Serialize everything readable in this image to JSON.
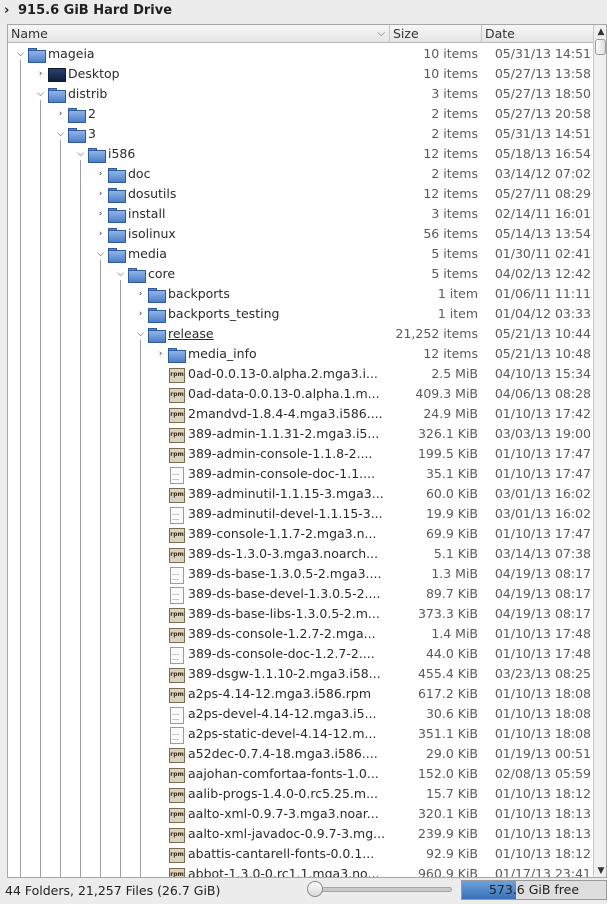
{
  "window": {
    "title": "915.6 GiB Hard Drive"
  },
  "columns": {
    "name": "Name",
    "size": "Size",
    "date": "Date"
  },
  "rows": [
    {
      "label": "mageia",
      "size": "10 items",
      "date": "05/31/13 14:51",
      "level": 0,
      "icon": "folder",
      "arrow": "open"
    },
    {
      "label": "Desktop",
      "size": "10 items",
      "date": "05/27/13 13:58",
      "level": 1,
      "icon": "desktop",
      "arrow": "closed"
    },
    {
      "label": "distrib",
      "size": "3 items",
      "date": "05/27/13 18:50",
      "level": 1,
      "icon": "folder",
      "arrow": "open"
    },
    {
      "label": "2",
      "size": "2 items",
      "date": "05/27/13 20:58",
      "level": 2,
      "icon": "folder",
      "arrow": "closed"
    },
    {
      "label": "3",
      "size": "2 items",
      "date": "05/31/13 14:51",
      "level": 2,
      "icon": "folder",
      "arrow": "open"
    },
    {
      "label": "i586",
      "size": "12 items",
      "date": "05/18/13 16:54",
      "level": 3,
      "icon": "folder",
      "arrow": "open"
    },
    {
      "label": "doc",
      "size": "2 items",
      "date": "03/14/12 07:02",
      "level": 4,
      "icon": "folder",
      "arrow": "closed"
    },
    {
      "label": "dosutils",
      "size": "12 items",
      "date": "05/27/11 08:29",
      "level": 4,
      "icon": "folder",
      "arrow": "closed"
    },
    {
      "label": "install",
      "size": "3 items",
      "date": "02/14/11 16:01",
      "level": 4,
      "icon": "folder",
      "arrow": "closed"
    },
    {
      "label": "isolinux",
      "size": "56 items",
      "date": "05/14/13 13:54",
      "level": 4,
      "icon": "folder",
      "arrow": "closed"
    },
    {
      "label": "media",
      "size": "5 items",
      "date": "01/30/11 02:41",
      "level": 4,
      "icon": "folder",
      "arrow": "open"
    },
    {
      "label": "core",
      "size": "5 items",
      "date": "04/02/13 12:42",
      "level": 5,
      "icon": "folder",
      "arrow": "open"
    },
    {
      "label": "backports",
      "size": "1 item",
      "date": "01/06/11 11:11",
      "level": 6,
      "icon": "folder",
      "arrow": "closed"
    },
    {
      "label": "backports_testing",
      "size": "1 item",
      "date": "01/04/12 03:33",
      "level": 6,
      "icon": "folder",
      "arrow": "closed"
    },
    {
      "label": "release",
      "size": "21,252 items",
      "date": "05/21/13 10:44",
      "level": 6,
      "icon": "folder",
      "arrow": "open",
      "underline": true
    },
    {
      "label": "media_info",
      "size": "12 items",
      "date": "05/21/13 10:48",
      "level": 7,
      "icon": "folder",
      "arrow": "closed"
    },
    {
      "label": "0ad-0.0.13-0.alpha.2.mga3.i...",
      "size": "2.5 MiB",
      "date": "04/10/13 15:34",
      "level": 7,
      "icon": "pkg",
      "arrow": "none"
    },
    {
      "label": "0ad-data-0.0.13-0.alpha.1.m...",
      "size": "409.3 MiB",
      "date": "04/06/13 08:28",
      "level": 7,
      "icon": "pkg",
      "arrow": "none"
    },
    {
      "label": "2mandvd-1.8.4-4.mga3.i586....",
      "size": "24.9 MiB",
      "date": "01/10/13 17:42",
      "level": 7,
      "icon": "pkg",
      "arrow": "none"
    },
    {
      "label": "389-admin-1.1.31-2.mga3.i5...",
      "size": "326.1 KiB",
      "date": "03/03/13 19:00",
      "level": 7,
      "icon": "pkg",
      "arrow": "none"
    },
    {
      "label": "389-admin-console-1.1.8-2....",
      "size": "199.5 KiB",
      "date": "01/10/13 17:47",
      "level": 7,
      "icon": "pkg",
      "arrow": "none"
    },
    {
      "label": "389-admin-console-doc-1.1....",
      "size": "35.1 KiB",
      "date": "01/10/13 17:47",
      "level": 7,
      "icon": "doc",
      "arrow": "none"
    },
    {
      "label": "389-adminutil-1.1.15-3.mga3...",
      "size": "60.0 KiB",
      "date": "03/01/13 16:02",
      "level": 7,
      "icon": "pkg",
      "arrow": "none"
    },
    {
      "label": "389-adminutil-devel-1.1.15-3...",
      "size": "19.9 KiB",
      "date": "03/01/13 16:02",
      "level": 7,
      "icon": "doc",
      "arrow": "none"
    },
    {
      "label": "389-console-1.1.7-2.mga3.n...",
      "size": "69.9 KiB",
      "date": "01/10/13 17:47",
      "level": 7,
      "icon": "pkg",
      "arrow": "none"
    },
    {
      "label": "389-ds-1.3.0-3.mga3.noarch...",
      "size": "5.1 KiB",
      "date": "03/14/13 07:38",
      "level": 7,
      "icon": "pkg",
      "arrow": "none"
    },
    {
      "label": "389-ds-base-1.3.0.5-2.mga3....",
      "size": "1.3 MiB",
      "date": "04/19/13 08:17",
      "level": 7,
      "icon": "doc",
      "arrow": "none"
    },
    {
      "label": "389-ds-base-devel-1.3.0.5-2....",
      "size": "89.7 KiB",
      "date": "04/19/13 08:17",
      "level": 7,
      "icon": "doc",
      "arrow": "none"
    },
    {
      "label": "389-ds-base-libs-1.3.0.5-2.m...",
      "size": "373.3 KiB",
      "date": "04/19/13 08:17",
      "level": 7,
      "icon": "pkg",
      "arrow": "none"
    },
    {
      "label": "389-ds-console-1.2.7-2.mga...",
      "size": "1.4 MiB",
      "date": "01/10/13 17:48",
      "level": 7,
      "icon": "pkg",
      "arrow": "none"
    },
    {
      "label": "389-ds-console-doc-1.2.7-2....",
      "size": "44.0 KiB",
      "date": "01/10/13 17:48",
      "level": 7,
      "icon": "doc",
      "arrow": "none"
    },
    {
      "label": "389-dsgw-1.1.10-2.mga3.i58...",
      "size": "455.4 KiB",
      "date": "03/23/13 08:25",
      "level": 7,
      "icon": "pkg",
      "arrow": "none"
    },
    {
      "label": "a2ps-4.14-12.mga3.i586.rpm",
      "size": "617.2 KiB",
      "date": "01/10/13 18:08",
      "level": 7,
      "icon": "pkg",
      "arrow": "none"
    },
    {
      "label": "a2ps-devel-4.14-12.mga3.i5...",
      "size": "30.6 KiB",
      "date": "01/10/13 18:08",
      "level": 7,
      "icon": "doc",
      "arrow": "none"
    },
    {
      "label": "a2ps-static-devel-4.14-12.m...",
      "size": "351.1 KiB",
      "date": "01/10/13 18:08",
      "level": 7,
      "icon": "doc",
      "arrow": "none"
    },
    {
      "label": "a52dec-0.7.4-18.mga3.i586....",
      "size": "29.0 KiB",
      "date": "01/19/13 00:51",
      "level": 7,
      "icon": "pkg",
      "arrow": "none"
    },
    {
      "label": "aajohan-comfortaa-fonts-1.0...",
      "size": "152.0 KiB",
      "date": "02/08/13 05:59",
      "level": 7,
      "icon": "pkg",
      "arrow": "none"
    },
    {
      "label": "aalib-progs-1.4.0-0.rc5.25.m...",
      "size": "15.7 KiB",
      "date": "01/10/13 18:12",
      "level": 7,
      "icon": "pkg",
      "arrow": "none"
    },
    {
      "label": "aalto-xml-0.9.7-3.mga3.noar...",
      "size": "320.1 KiB",
      "date": "01/10/13 18:13",
      "level": 7,
      "icon": "pkg",
      "arrow": "none"
    },
    {
      "label": "aalto-xml-javadoc-0.9.7-3.mg...",
      "size": "239.9 KiB",
      "date": "01/10/13 18:13",
      "level": 7,
      "icon": "pkg",
      "arrow": "none"
    },
    {
      "label": "abattis-cantarell-fonts-0.0.1...",
      "size": "92.9 KiB",
      "date": "01/10/13 18:12",
      "level": 7,
      "icon": "pkg",
      "arrow": "none"
    },
    {
      "label": "abbot-1.3.0-0.rc1.1.mga3.no...",
      "size": "960.9 KiB",
      "date": "01/17/13 23:41",
      "level": 7,
      "icon": "pkg",
      "arrow": "none"
    }
  ],
  "status": {
    "summary": "44 Folders, 21,257 Files (26.7 GiB)",
    "free_space": "573.6 GiB free",
    "free_space_used_fraction": 0.374,
    "zoom_fraction": 0.0
  },
  "colors": {
    "folder": "#5b86c5",
    "accent": "#3a72b8"
  }
}
